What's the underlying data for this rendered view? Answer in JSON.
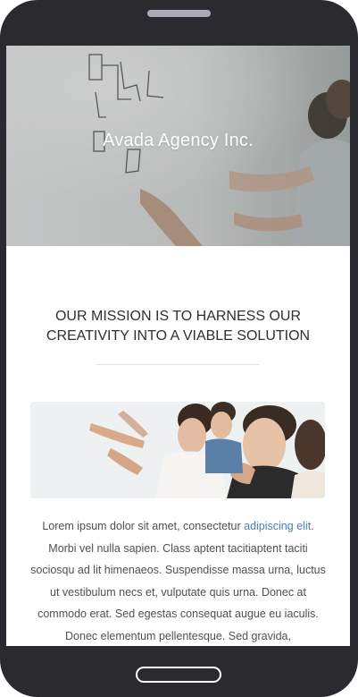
{
  "hero": {
    "title": "Avada Agency Inc."
  },
  "mission": {
    "line1": "OUR MISSION IS TO HARNESS OUR",
    "line2": "CREATIVITY INTO A VIABLE SOLUTION"
  },
  "content": {
    "text_before_link": "Lorem ipsum dolor sit amet, consectetur ",
    "link_text": "adipiscing elit",
    "text_after_link": ". Morbi vel nulla sapien. Class aptent tacitiaptent taciti sociosqu ad lit himenaeos. Suspendisse massa urna, luctus ut vestibulum necs et, vulputate quis urna. Donec at commodo erat. Sed egestas consequat augue eu iaculis. Donec elementum pellentesque. Sed gravida,"
  },
  "icons": {
    "phone_speaker": "speaker-grille",
    "home_button": "home-button"
  },
  "colors": {
    "phone_body": "#2b2b2f",
    "link": "#4a7fb8",
    "body_text": "#505050"
  }
}
